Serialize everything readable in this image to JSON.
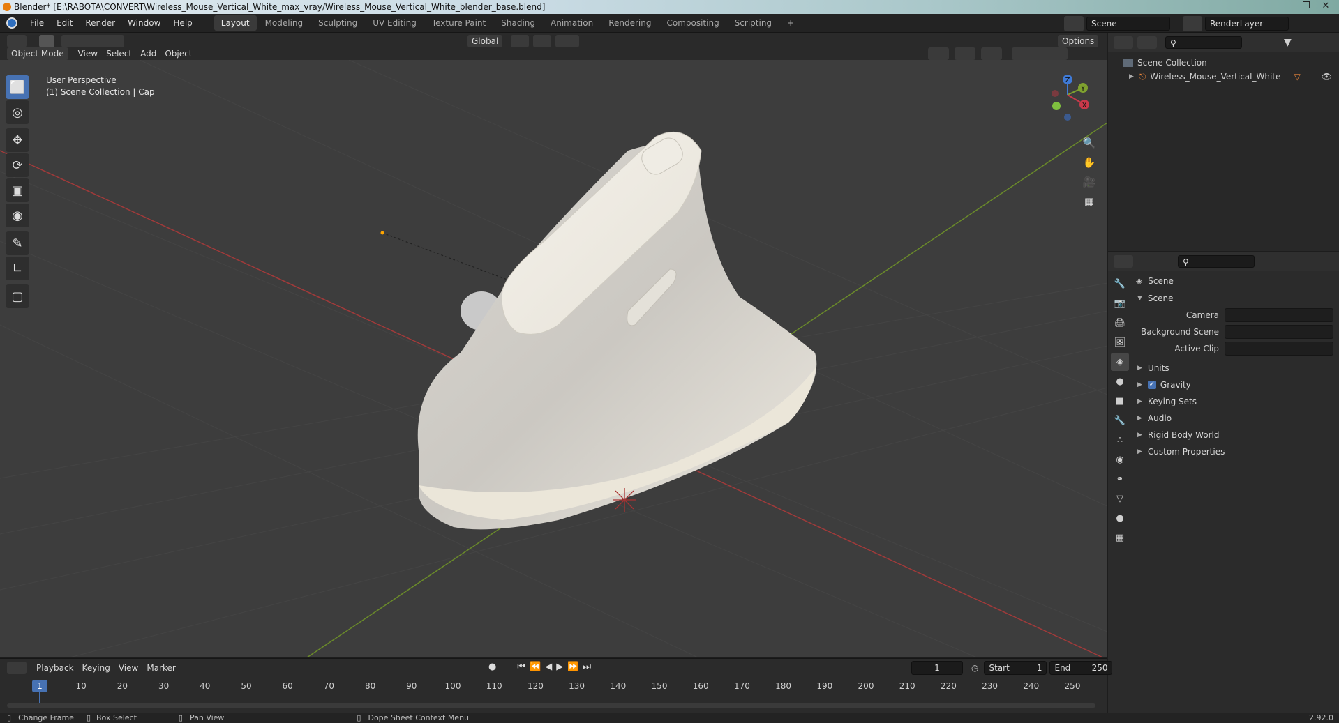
{
  "window": {
    "title": "Blender* [E:\\RABOTA\\CONVERT\\Wireless_Mouse_Vertical_White_max_vray/Wireless_Mouse_Vertical_White_blender_base.blend]"
  },
  "menus": [
    "File",
    "Edit",
    "Render",
    "Window",
    "Help"
  ],
  "workspaces": [
    "Layout",
    "Modeling",
    "Sculpting",
    "UV Editing",
    "Texture Paint",
    "Shading",
    "Animation",
    "Rendering",
    "Compositing",
    "Scripting"
  ],
  "active_workspace": "Layout",
  "scene_name": "Scene",
  "render_layer": "RenderLayer",
  "viewport": {
    "mode": "Object Mode",
    "menu": [
      "View",
      "Select",
      "Add",
      "Object"
    ],
    "orientation": "Global",
    "options_label": "Options",
    "info_line1": "User Perspective",
    "info_line2": "(1) Scene Collection | Cap",
    "gizmo": {
      "x": "X",
      "y": "Y",
      "z": "Z"
    }
  },
  "outliner": {
    "root": "Scene Collection",
    "items": [
      {
        "label": "Wireless_Mouse_Vertical_White"
      }
    ]
  },
  "properties": {
    "header": "Scene",
    "section": "Scene",
    "fields": [
      {
        "label": "Camera"
      },
      {
        "label": "Background Scene"
      },
      {
        "label": "Active Clip"
      }
    ],
    "panels": [
      "Units",
      "Gravity",
      "Keying Sets",
      "Audio",
      "Rigid Body World",
      "Custom Properties"
    ],
    "gravity_checked": true
  },
  "timeline": {
    "menu": [
      "Playback",
      "Keying",
      "View",
      "Marker"
    ],
    "current_frame": "1",
    "start_label": "Start",
    "start": "1",
    "end_label": "End",
    "end": "250",
    "ticks": [
      "10",
      "20",
      "30",
      "40",
      "50",
      "60",
      "70",
      "80",
      "90",
      "100",
      "110",
      "120",
      "130",
      "140",
      "150",
      "160",
      "170",
      "180",
      "190",
      "200",
      "210",
      "220",
      "230",
      "240",
      "250"
    ],
    "playhead": "1"
  },
  "status": {
    "items": [
      "Change Frame",
      "Box Select",
      "Pan View",
      "Dope Sheet Context Menu"
    ],
    "version": "2.92.0"
  },
  "icons": [
    "blender-logo-icon",
    "select-box-icon",
    "cursor-icon",
    "move-icon",
    "rotate-icon",
    "scale-icon",
    "transform-icon",
    "annotate-icon",
    "measure-icon",
    "add-cube-icon",
    "zoom-icon",
    "hand-icon",
    "camera-icon",
    "grid-icon",
    "eye-icon",
    "filter-icon",
    "search-icon"
  ]
}
